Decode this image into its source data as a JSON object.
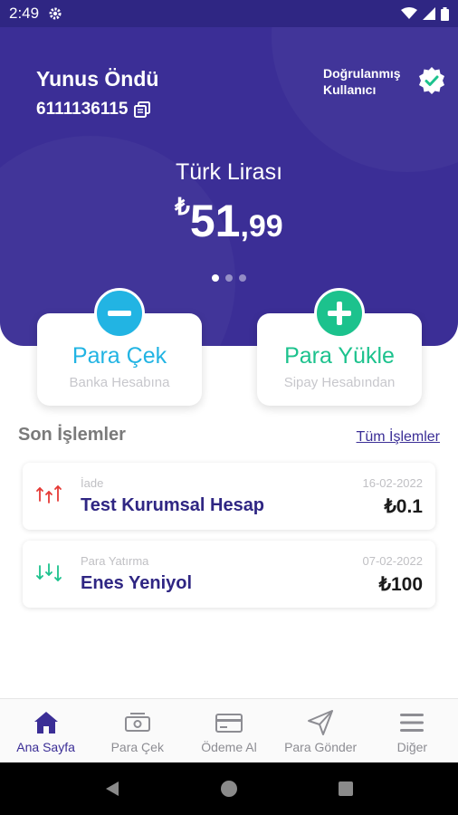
{
  "status_bar": {
    "time": "2:49",
    "icons": [
      "settings-icon",
      "wifi-icon",
      "signal-icon",
      "battery-icon"
    ]
  },
  "user": {
    "name": "Yunus Öndü",
    "phone": "6111136115",
    "verified_line1": "Doğrulanmış",
    "verified_line2": "Kullanıcı"
  },
  "balance": {
    "currency_name": "Türk Lirası",
    "symbol": "₺",
    "integer": "51",
    "decimal": ",99",
    "page_count": 3,
    "active_page": 1
  },
  "actions": {
    "withdraw": {
      "title": "Para Çek",
      "subtitle": "Banka Hesabına",
      "color": "#22b4e3"
    },
    "load": {
      "title": "Para Yükle",
      "subtitle": "Sipay Hesabından",
      "color": "#1cc28d"
    }
  },
  "transactions": {
    "title": "Son İşlemler",
    "see_all": "Tüm İşlemler",
    "items": [
      {
        "type": "İade",
        "name": "Test Kurumsal Hesap",
        "date": "16-02-2022",
        "amount": "₺0.1",
        "icon": "refund-arrows-icon",
        "color": "#e53935"
      },
      {
        "type": "Para Yatırma",
        "name": "Enes Yeniyol",
        "date": "07-02-2022",
        "amount": "₺100",
        "icon": "deposit-arrows-icon",
        "color": "#1cc28d"
      }
    ]
  },
  "bottom_nav": {
    "items": [
      {
        "label": "Ana Sayfa",
        "icon": "home-icon",
        "active": true
      },
      {
        "label": "Para Çek",
        "icon": "cash-icon",
        "active": false
      },
      {
        "label": "Ödeme Al",
        "icon": "card-icon",
        "active": false
      },
      {
        "label": "Para Gönder",
        "icon": "send-icon",
        "active": false
      },
      {
        "label": "Diğer",
        "icon": "menu-icon",
        "active": false
      }
    ]
  },
  "colors": {
    "primary": "#3b2e96",
    "accent_blue": "#22b4e3",
    "accent_green": "#1cc28d"
  }
}
